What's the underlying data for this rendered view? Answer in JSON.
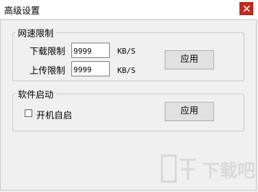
{
  "window": {
    "title": "高级设置",
    "close_icon": "close-icon"
  },
  "speed_group": {
    "legend": "网速限制",
    "download_label": "下载限制",
    "download_value": "9999",
    "download_unit": "KB/S",
    "upload_label": "上传限制",
    "upload_value": "9999",
    "upload_unit": "KB/S",
    "apply_label": "应用"
  },
  "startup_group": {
    "legend": "软件启动",
    "autostart_label": "开机自启",
    "autostart_checked": false,
    "apply_label": "应用"
  },
  "watermark": {
    "text": "下载吧",
    "icon": "download-watermark-logo",
    "color": "#c8c8c8"
  },
  "colors": {
    "close_button": "#c42b1c",
    "window_bg": "#f0f0f0"
  }
}
